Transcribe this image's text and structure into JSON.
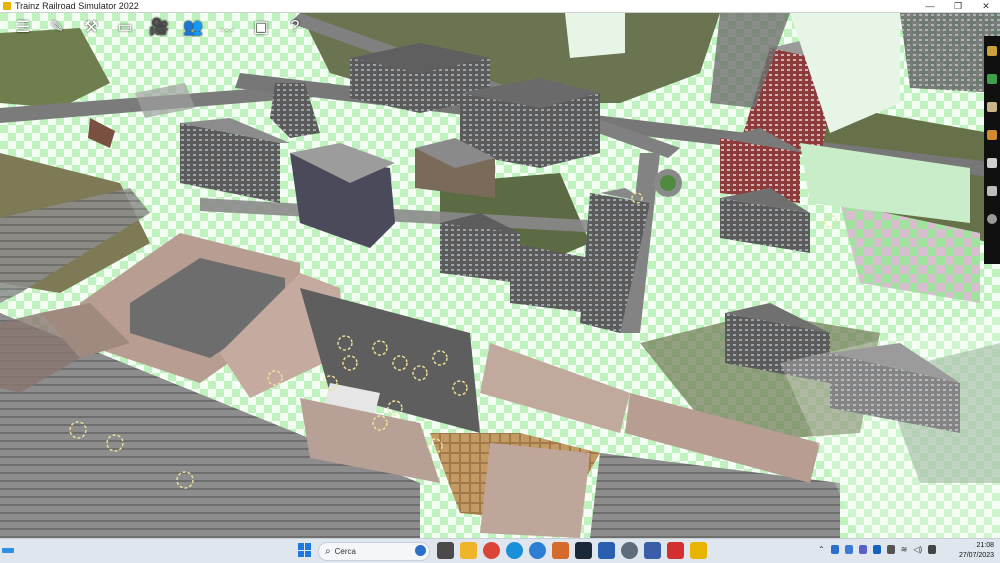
{
  "window": {
    "title": "Trainz Railroad Simulator 2022",
    "controls": [
      "—",
      "❐",
      "✕"
    ]
  },
  "toolbar": {
    "items": [
      {
        "name": "menu-icon",
        "glyph": "☰"
      },
      {
        "name": "edit-icon",
        "glyph": "✎"
      },
      {
        "name": "tools-icon",
        "glyph": "⚒"
      },
      {
        "name": "monitor-icon",
        "glyph": "▭"
      },
      {
        "name": "camera-icon",
        "glyph": "🎥"
      },
      {
        "name": "people-icon",
        "glyph": "👥"
      },
      {
        "name": "chat-icon",
        "glyph": "…"
      },
      {
        "name": "window-icon",
        "glyph": "▣"
      },
      {
        "name": "help-icon",
        "glyph": "?"
      }
    ]
  },
  "sidestrip": {
    "items": [
      {
        "name": "terrain-tool-icon",
        "color": "#c9a03a"
      },
      {
        "name": "track-tool-icon",
        "color": "#3fa04a"
      },
      {
        "name": "objects-tool-icon",
        "color": "#c8b58a"
      },
      {
        "name": "rail-tool-icon",
        "color": "#d08a30"
      },
      {
        "name": "wrench-tool-icon",
        "color": "#cfcfcf"
      },
      {
        "name": "layers-tool-icon",
        "color": "#bdbdbd"
      },
      {
        "name": "settings-tool-icon",
        "color": "#9a9a9a"
      }
    ]
  },
  "taskbar": {
    "search_placeholder": "Cerca",
    "apps": [
      {
        "name": "task-view-icon",
        "color": "#4a4a4a"
      },
      {
        "name": "file-explorer-icon",
        "color": "#f0b429"
      },
      {
        "name": "chrome-icon",
        "color": "#db4437"
      },
      {
        "name": "edge-icon",
        "color": "#1b8fd8"
      },
      {
        "name": "help-app-icon",
        "color": "#2d7fd3"
      },
      {
        "name": "home-app-icon",
        "color": "#d46a2c"
      },
      {
        "name": "steam-icon",
        "color": "#1b2838"
      },
      {
        "name": "shield-app-icon",
        "color": "#2a5fb0"
      },
      {
        "name": "settings-app-icon",
        "color": "#5d6b7a"
      },
      {
        "name": "remote-app-icon",
        "color": "#3b5ea8"
      },
      {
        "name": "acrobat-icon",
        "color": "#d32f2f"
      },
      {
        "name": "trainz-app-icon",
        "color": "#e8b400"
      }
    ],
    "clock": {
      "time": "21:08",
      "date": "27/07/2023"
    }
  }
}
